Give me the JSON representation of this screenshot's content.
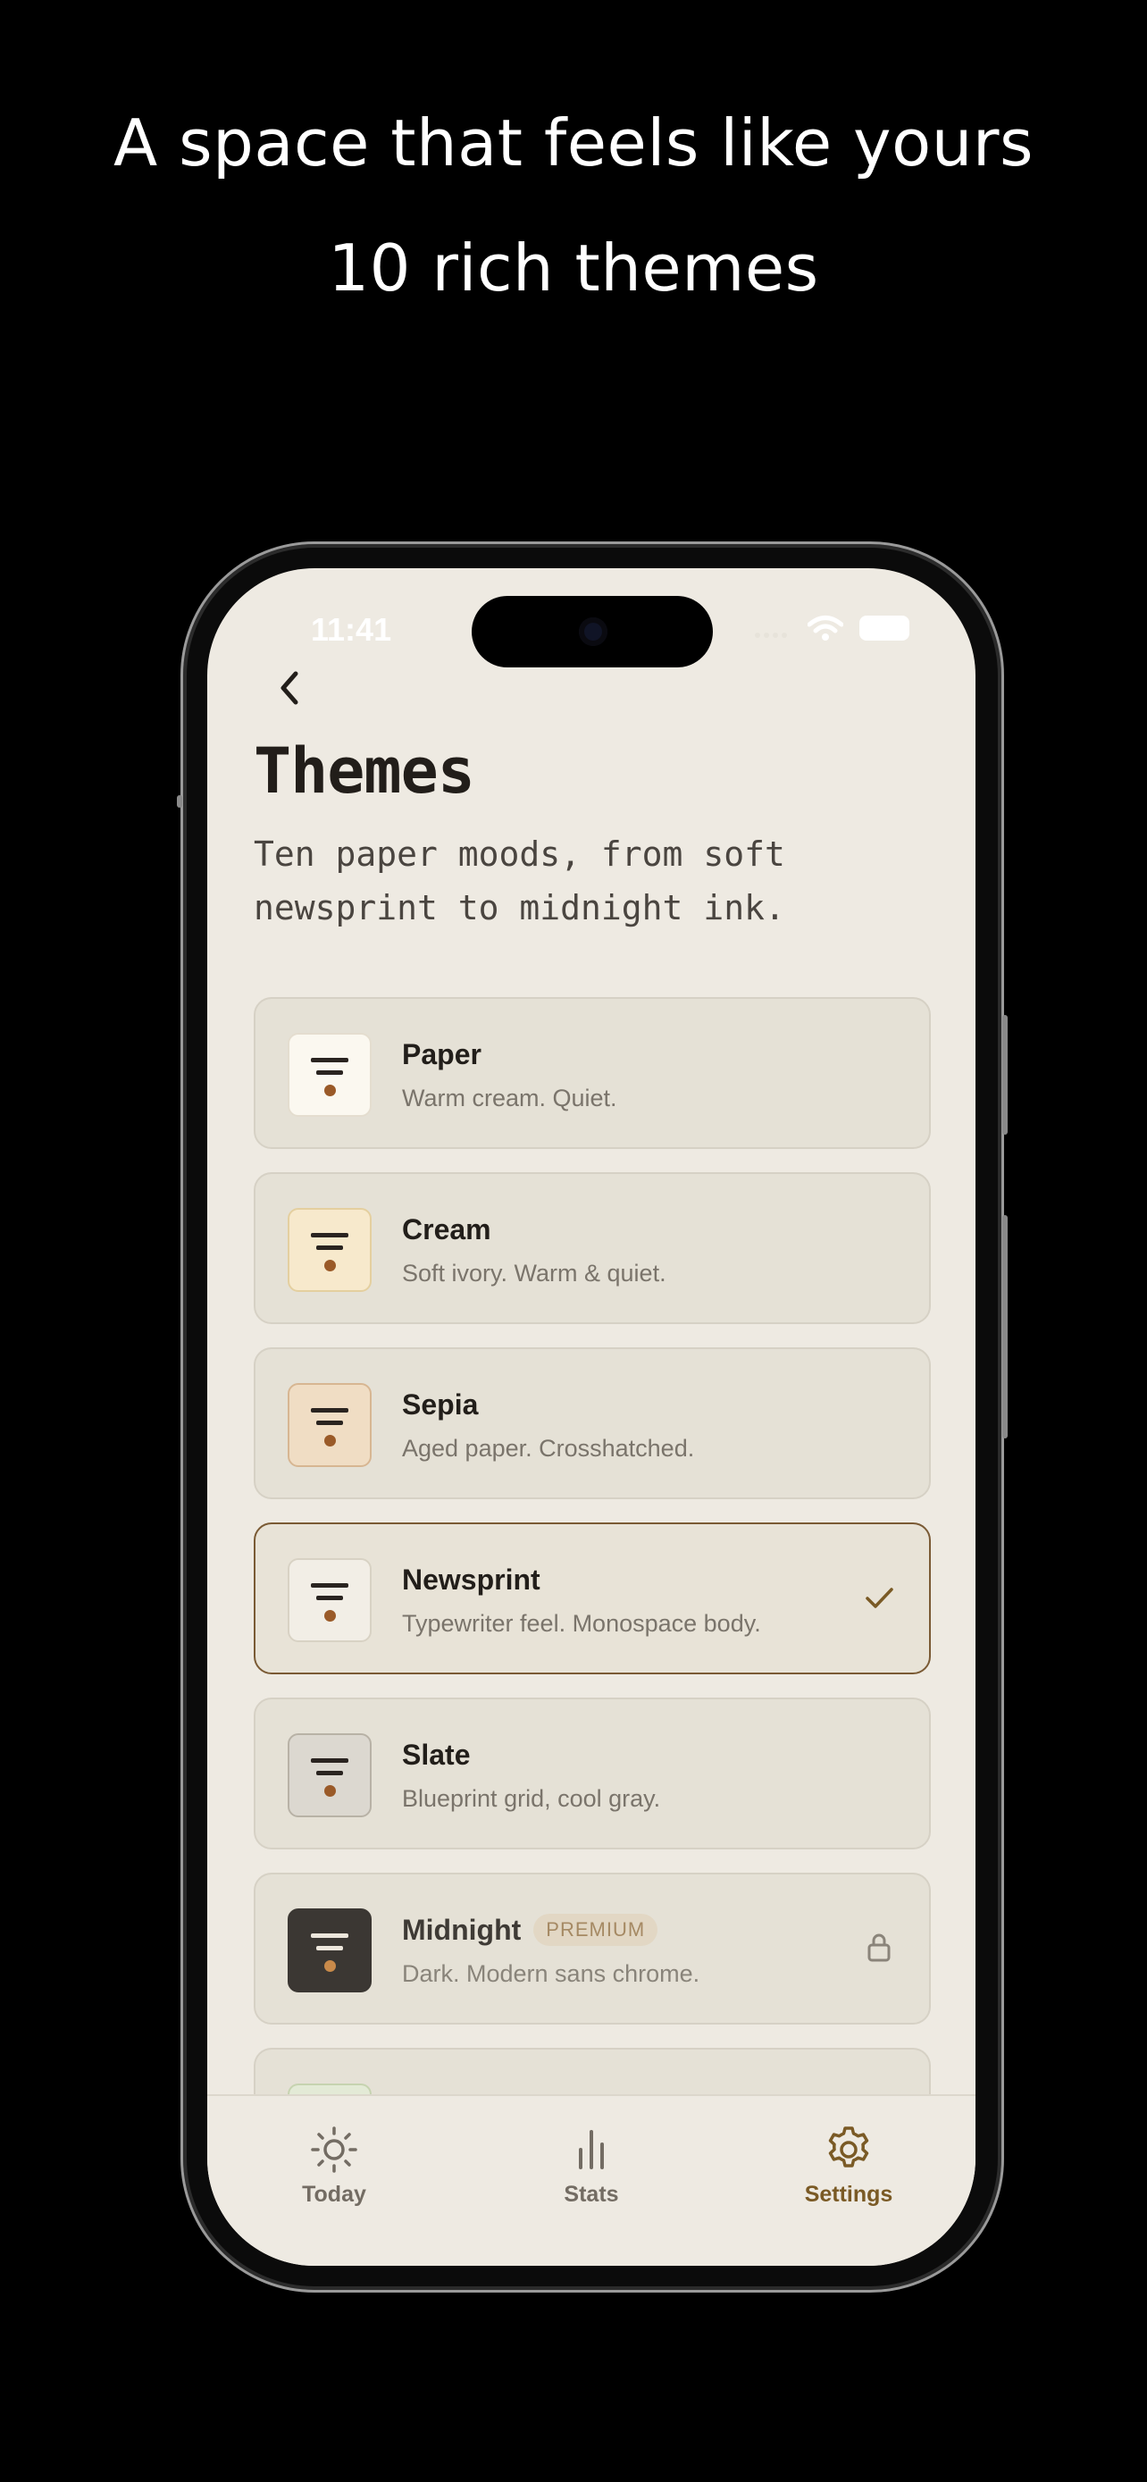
{
  "headline": {
    "line1": "A space that feels like yours",
    "line2": "10 rich themes"
  },
  "status_bar": {
    "time": "11:41",
    "icons": [
      "signal-icon",
      "wifi-icon",
      "battery-icon"
    ]
  },
  "header": {
    "back_icon": "chevron-left-icon",
    "title": "Themes",
    "subtitle": "Ten paper moods, from soft newsprint to midnight ink."
  },
  "themes": [
    {
      "name": "Paper",
      "description": "Warm cream. Quiet.",
      "swatch": "#FBF8F0",
      "swatch_border": "#e4ddcf",
      "selected": false,
      "premium": false
    },
    {
      "name": "Cream",
      "description": "Soft ivory. Warm & quiet.",
      "swatch": "#F7E9CC",
      "swatch_border": "#e4cf9f",
      "selected": false,
      "premium": false
    },
    {
      "name": "Sepia",
      "description": "Aged paper. Crosshatched.",
      "swatch": "#F0DDC4",
      "swatch_border": "#d7b692",
      "selected": false,
      "premium": false
    },
    {
      "name": "Newsprint",
      "description": "Typewriter feel. Monospace body.",
      "swatch": "#F2EEE6",
      "swatch_border": "#d8d2c4",
      "selected": true,
      "premium": false
    },
    {
      "name": "Slate",
      "description": "Blueprint grid, cool gray.",
      "swatch": "#DCD8D0",
      "swatch_border": "#b8b2a6",
      "selected": false,
      "premium": false
    },
    {
      "name": "Midnight",
      "description": "Dark. Modern sans chrome.",
      "swatch": "#3b3733",
      "swatch_border": "#3b3733",
      "selected": false,
      "premium": true,
      "badge": "PREMIUM"
    }
  ],
  "tabbar": {
    "tabs": [
      {
        "label": "Today",
        "icon": "sun-icon",
        "active": false
      },
      {
        "label": "Stats",
        "icon": "bar-chart-icon",
        "active": false
      },
      {
        "label": "Settings",
        "icon": "gear-icon",
        "active": true
      }
    ]
  },
  "colors": {
    "accent": "#7a5a25",
    "background": "#EEEAE2",
    "card": "#E5E1D6",
    "dot": "#9a5a28"
  }
}
